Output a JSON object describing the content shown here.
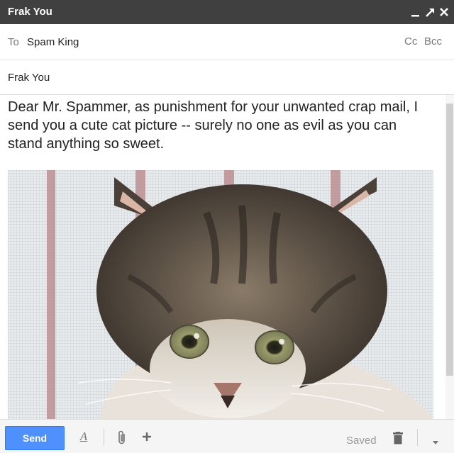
{
  "window": {
    "title": "Frak You",
    "controls": [
      "minimize-icon",
      "popout-icon",
      "close-icon"
    ]
  },
  "recipients": {
    "to_label": "To",
    "to_value": "Spam King",
    "cc_label": "Cc",
    "bcc_label": "Bcc"
  },
  "subject": "Frak You",
  "body": {
    "text": "Dear Mr. Spammer, as punishment for your unwanted crap mail, I send you a cute cat picture -- surely no one as evil as you can stand anything so sweet.",
    "image": "tabby-kitten-photo"
  },
  "footer": {
    "send_label": "Send",
    "format_icon": "text-format-icon",
    "attach_icon": "paperclip-icon",
    "insert_icon": "plus-icon",
    "status": "Saved",
    "discard_icon": "trash-icon",
    "more_icon": "dropdown-arrow-icon"
  },
  "colors": {
    "titlebar": "#404040",
    "send_button": "#4d90fe"
  }
}
